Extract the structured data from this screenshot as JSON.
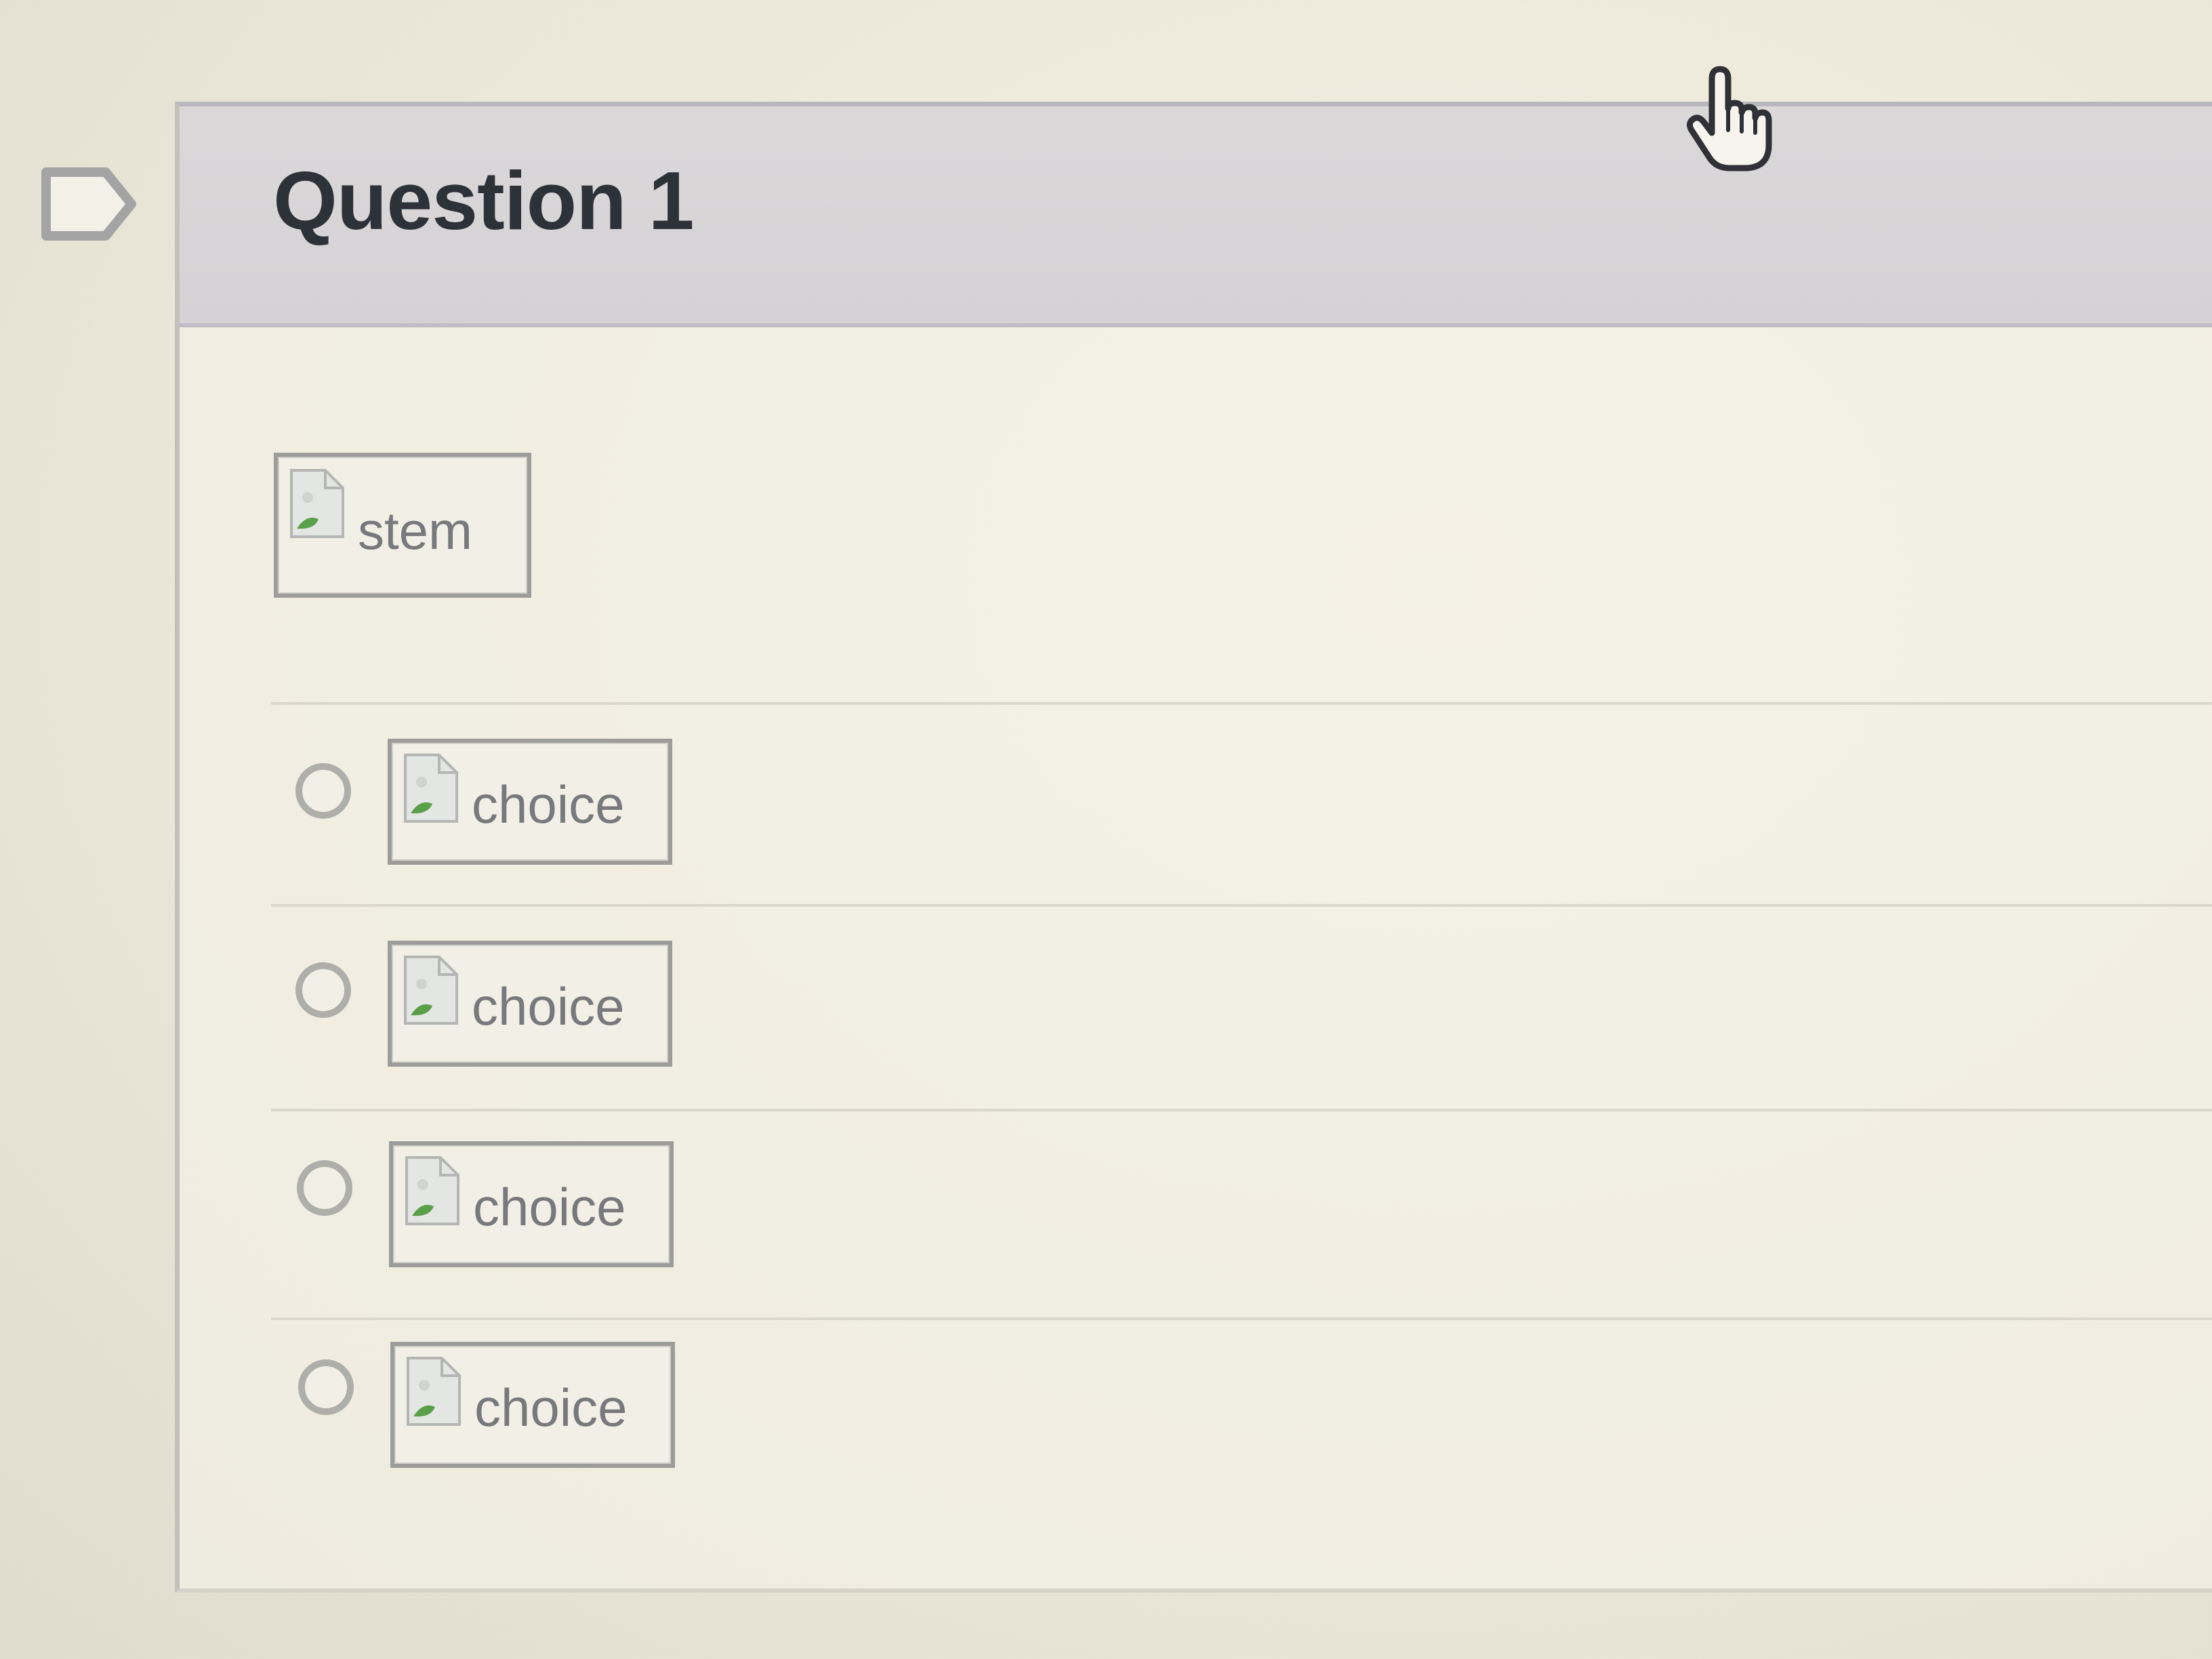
{
  "question": {
    "title": "Question 1",
    "stem_image_alt": "stem",
    "choices": [
      {
        "image_alt": "choice",
        "selected": false
      },
      {
        "image_alt": "choice",
        "selected": false
      },
      {
        "image_alt": "choice",
        "selected": false
      },
      {
        "image_alt": "choice",
        "selected": false
      }
    ]
  },
  "icons": {
    "flag": "flag-icon",
    "broken_image": "broken-image-icon",
    "cursor": "hand-pointer-icon"
  },
  "colors": {
    "header_background": "#d6d4d6",
    "page_background": "#ebe8d9",
    "title_text": "#2d3138",
    "border": "#b9b7be"
  }
}
